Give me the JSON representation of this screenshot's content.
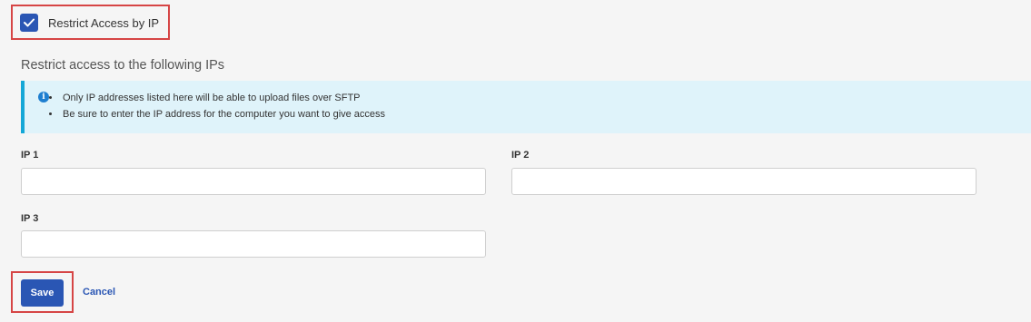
{
  "restrict_access": {
    "label": "Restrict Access by IP",
    "checked": true
  },
  "section_title": "Restrict access to the following IPs",
  "info_alert": {
    "icon": "info-icon",
    "items": [
      "Only IP addresses listed here will be able to upload files over SFTP",
      "Be sure to enter the IP address for the computer you want to give access"
    ]
  },
  "fields": [
    {
      "label": "IP 1",
      "value": ""
    },
    {
      "label": "IP 2",
      "value": ""
    },
    {
      "label": "IP 3",
      "value": ""
    }
  ],
  "actions": {
    "save_label": "Save",
    "cancel_label": "Cancel"
  },
  "colors": {
    "primary": "#2a56b4",
    "alert_bg": "#dff3fa",
    "alert_border": "#13a7d7",
    "highlight": "#d64545"
  }
}
